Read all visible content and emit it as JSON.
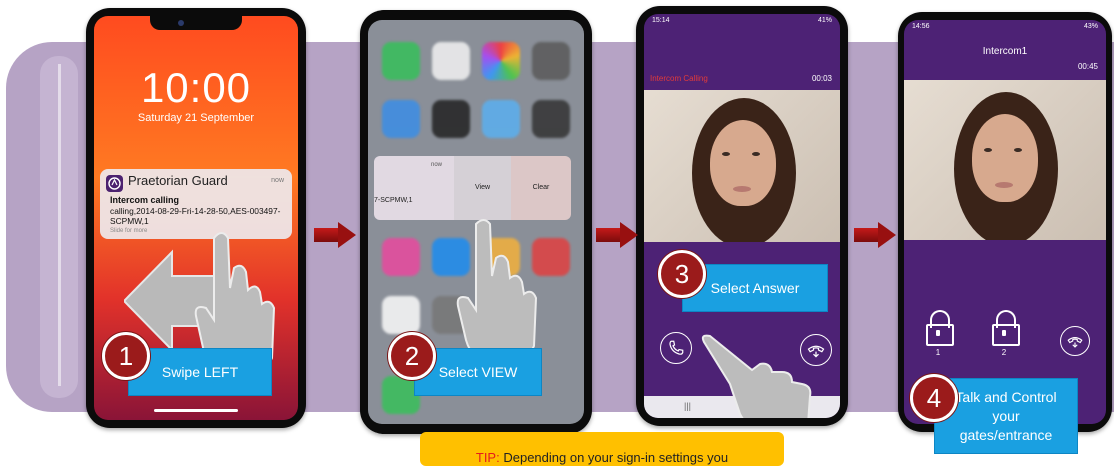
{
  "phone1": {
    "clock": "10:00",
    "date": "Saturday 21 September",
    "notification": {
      "app": "Praetorian Guard",
      "time": "now",
      "title": "Intercom calling",
      "body": "calling,2014-08-29-Fri-14-28-50,AES-003497-SCPMW,1",
      "hint": "Slide for more"
    }
  },
  "phone2": {
    "context_time": "now",
    "context_text": "7-SCPMW,1",
    "view_label": "View",
    "clear_label": "Clear"
  },
  "phone3": {
    "status_time": "15:14",
    "status_right": "41%",
    "caller_label": "Intercom Calling",
    "timer": "00:03"
  },
  "phone4": {
    "status_time": "14:56",
    "status_right": "43%",
    "title": "Intercom1",
    "timer": "00:45",
    "lock_labels": [
      "1",
      "2"
    ]
  },
  "steps": [
    {
      "number": "1",
      "label": "Swipe LEFT"
    },
    {
      "number": "2",
      "label": "Select VIEW"
    },
    {
      "number": "3",
      "label": "Select Answer"
    },
    {
      "number": "4",
      "label": "Talk and Control your gates/entrance"
    }
  ],
  "tip": {
    "prefix": "TIP:",
    "text": "Depending on your sign-in settings you"
  },
  "colors": {
    "band": "#b6a3c5",
    "call_purple": "#4d2275",
    "step_blue": "#1aa0e1",
    "badge_red": "#9b1b1b",
    "arrow_red": "#9b1010",
    "tip_yellow": "#ffc000"
  }
}
